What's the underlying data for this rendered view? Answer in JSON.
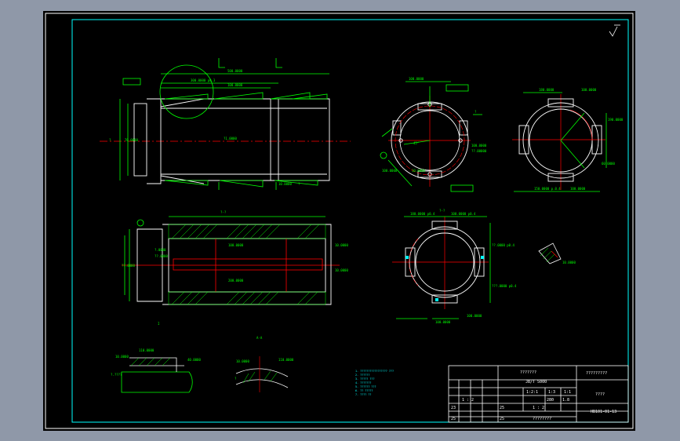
{
  "cad_viewer": {
    "colors": {
      "app_background": "#8f98a8",
      "model_background": "#000000",
      "border": "#ffffff",
      "frame": "#00ffff",
      "geometry": "#00ff00",
      "centerline": "#ff0000",
      "dimension": "#00ff00",
      "hatch": "#00ff00",
      "hidden_feature": "#ffff00",
      "annotation": "#ffffff"
    },
    "icons": {
      "roughness_symbol": "roughness-check-icon"
    }
  },
  "title_block": {
    "row1_left_label": "???????",
    "row1_right_label": "?????????",
    "row2_standard": "JB/T 5000",
    "row3_code_a": "1:2:1",
    "row3_code_b": "1:3",
    "row3_code_c": "1:1",
    "row3_part_name": "????",
    "row4_weight": "280",
    "row4_scale": "1.8",
    "row5_ratio": "1 : 2",
    "row6_num_a": "23",
    "row6_num_b": "1 : 2",
    "row6_num_c": "25",
    "drawing_number": "HB101-01-13",
    "row7_num_a": "25",
    "row7_num_b": "25",
    "company": "????????"
  },
  "tech_notes": [
    "1. ????????????????? ???",
    "2. ??????",
    "3. ????? ???",
    "4. ???????",
    "5. ?????? ???",
    "6. ?? ?????",
    "7. ???? ??"
  ]
}
